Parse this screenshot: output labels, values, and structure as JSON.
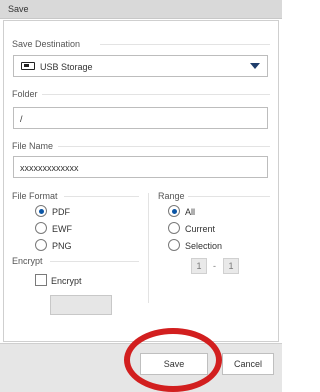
{
  "dialog": {
    "title": "Save"
  },
  "save_destination": {
    "label": "Save Destination",
    "value": "USB Storage",
    "icon": "usb-storage-icon"
  },
  "folder": {
    "label": "Folder",
    "value": "/"
  },
  "file_name": {
    "label": "File Name",
    "value": "xxxxxxxxxxxxx"
  },
  "file_format": {
    "label": "File Format",
    "options": [
      {
        "label": "PDF",
        "selected": true
      },
      {
        "label": "EWF",
        "selected": false
      },
      {
        "label": "PNG",
        "selected": false
      }
    ]
  },
  "range": {
    "label": "Range",
    "options": [
      {
        "label": "All",
        "selected": true
      },
      {
        "label": "Current",
        "selected": false
      },
      {
        "label": "Selection",
        "selected": false
      }
    ],
    "from": "1",
    "separator": "-",
    "to": "1"
  },
  "encrypt": {
    "label": "Encrypt",
    "checkbox_label": "Encrypt",
    "checked": false
  },
  "buttons": {
    "save": "Save",
    "cancel": "Cancel"
  },
  "colors": {
    "accent": "#0a55a5",
    "highlight_ring": "#d21f1f"
  }
}
